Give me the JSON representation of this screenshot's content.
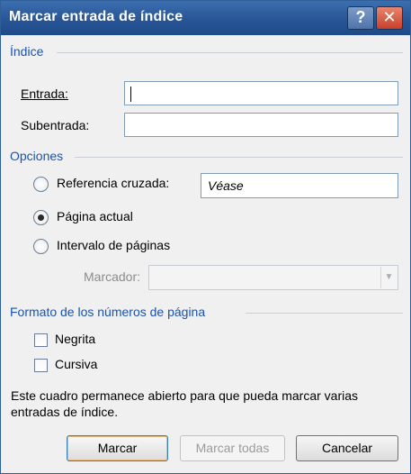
{
  "window": {
    "title": "Marcar entrada de índice"
  },
  "titlebar": {
    "help_label": "?",
    "close_label": "✕",
    "help_icon": "question-icon",
    "close_icon": "close-icon"
  },
  "indice": {
    "heading": "Índice",
    "entrada_label": "Entrada:",
    "entrada_value": "",
    "subentrada_label": "Subentrada:",
    "subentrada_value": ""
  },
  "opciones": {
    "heading": "Opciones",
    "referencia_label": "Referencia cruzada:",
    "referencia_value": "Véase",
    "pagina_actual_label": "Página actual",
    "intervalo_label": "Intervalo de páginas",
    "marcador_label": "Marcador:",
    "marcador_value": "",
    "selected": "Página actual"
  },
  "formato": {
    "heading": "Formato de los números de página",
    "negrita_label": "Negrita",
    "negrita_checked": false,
    "cursiva_label": "Cursiva",
    "cursiva_checked": false
  },
  "info_text": "Este cuadro permanece abierto para que pueda marcar varias entradas de índice.",
  "buttons": {
    "marcar": "Marcar",
    "marcar_todas": "Marcar todas",
    "cancelar": "Cancelar"
  },
  "colors": {
    "titlebar": "#2a5797",
    "section_heading": "#1a53b0",
    "close_button": "#c8402a",
    "dialog_background": "#f0f0f0"
  }
}
